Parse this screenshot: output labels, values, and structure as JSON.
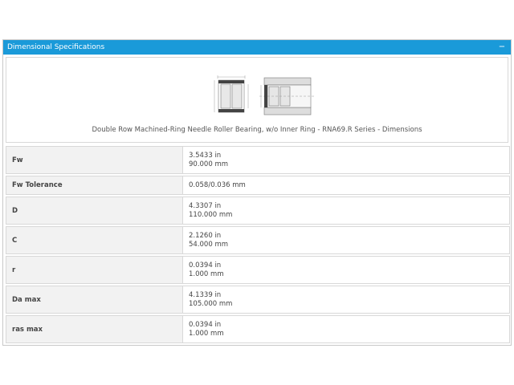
{
  "panel": {
    "title": "Dimensional Specifications",
    "collapse_label": "−"
  },
  "figure": {
    "caption": "Double Row Machined-Ring Needle Roller Bearing, w/o Inner Ring - RNA69.R Series - Dimensions"
  },
  "specs": [
    {
      "label": "Fw",
      "values": [
        "3.5433 in",
        "90.000 mm"
      ]
    },
    {
      "label": "Fw Tolerance",
      "values": [
        "0.058/0.036 mm"
      ]
    },
    {
      "label": "D",
      "values": [
        "4.3307 in",
        "110.000 mm"
      ]
    },
    {
      "label": "C",
      "values": [
        "2.1260 in",
        "54.000 mm"
      ]
    },
    {
      "label": "r",
      "values": [
        "0.0394 in",
        "1.000 mm"
      ]
    },
    {
      "label": "Da max",
      "values": [
        "4.1339 in",
        "105.000 mm"
      ]
    },
    {
      "label": "ras max",
      "values": [
        "0.0394 in",
        "1.000 mm"
      ]
    }
  ]
}
